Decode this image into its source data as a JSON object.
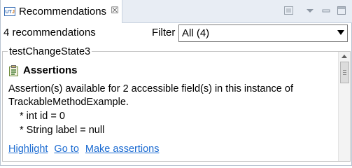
{
  "tab": {
    "title": "Recommendations",
    "icon": "utj-logo-icon",
    "close_glyph": "☒"
  },
  "toolbar": {
    "buttons": [
      "focus-view-icon",
      "view-menu-icon",
      "minimize-icon",
      "maximize-icon"
    ]
  },
  "summary": {
    "count_text": "4 recommendations",
    "filter_label": "Filter",
    "filter_value": "All (4)"
  },
  "group": {
    "title": "testChangeState3",
    "section_title": "Assertions",
    "description_line1": "Assertion(s) available for 2 accessible field(s) in this instance of",
    "description_line2": "TrackableMethodExample.",
    "fields": [
      "* int id = 0",
      "* String label = null"
    ],
    "links": [
      "Highlight",
      "Go to",
      "Make assertions"
    ]
  },
  "colors": {
    "link": "#1a6ad1",
    "tab_bar": "#e8edf4",
    "border": "#c6c6c6"
  }
}
